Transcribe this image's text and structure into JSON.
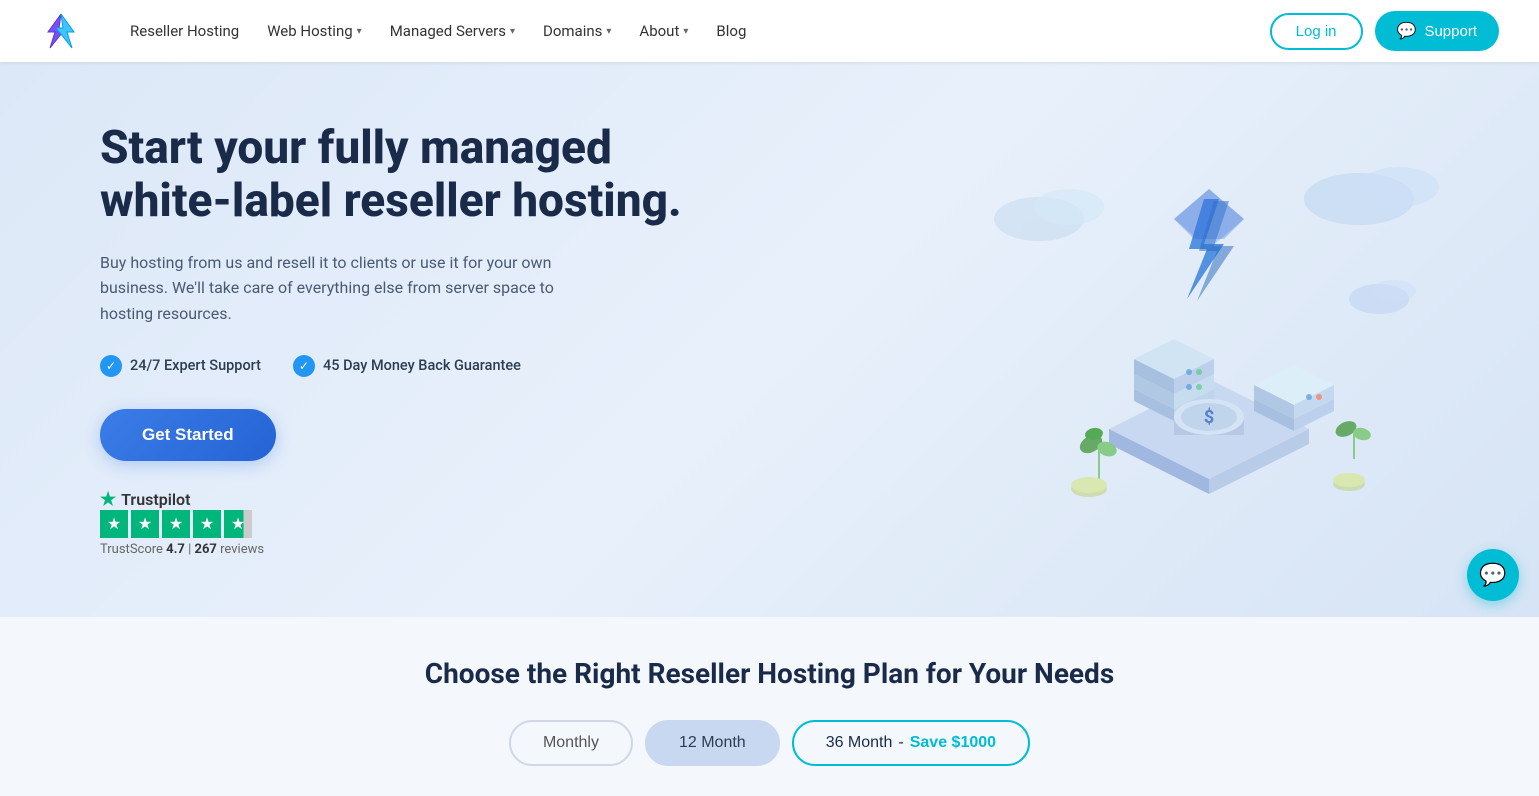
{
  "navbar": {
    "logo_alt": "Reseller Club Logo",
    "links": [
      {
        "label": "Reseller Hosting",
        "has_dropdown": false
      },
      {
        "label": "Web Hosting",
        "has_dropdown": true
      },
      {
        "label": "Managed Servers",
        "has_dropdown": true
      },
      {
        "label": "Domains",
        "has_dropdown": true
      },
      {
        "label": "About",
        "has_dropdown": true
      },
      {
        "label": "Blog",
        "has_dropdown": false
      }
    ],
    "login_label": "Log in",
    "support_label": "Support",
    "support_icon": "💬"
  },
  "hero": {
    "title": "Start your fully managed white-label reseller hosting.",
    "subtitle": "Buy hosting from us and resell it to clients or use it for your own business. We'll take care of everything else from server space to hosting resources.",
    "badges": [
      {
        "text": "24/7 Expert Support"
      },
      {
        "text": "45 Day Money Back Guarantee"
      }
    ],
    "cta_label": "Get Started",
    "trustpilot": {
      "brand": "Trustpilot",
      "score_label": "TrustScore",
      "score": "4.7",
      "separator": "|",
      "reviews_count": "267",
      "reviews_label": "reviews"
    }
  },
  "plans": {
    "title": "Choose the Right Reseller Hosting Plan for Your Needs",
    "tabs": [
      {
        "label": "Monthly",
        "state": "default"
      },
      {
        "label": "12 Month",
        "state": "active-blue"
      },
      {
        "label": "36 Month",
        "state": "active-teal",
        "save_text": "Save $1000"
      }
    ]
  },
  "fab": {
    "icon": "💬"
  }
}
